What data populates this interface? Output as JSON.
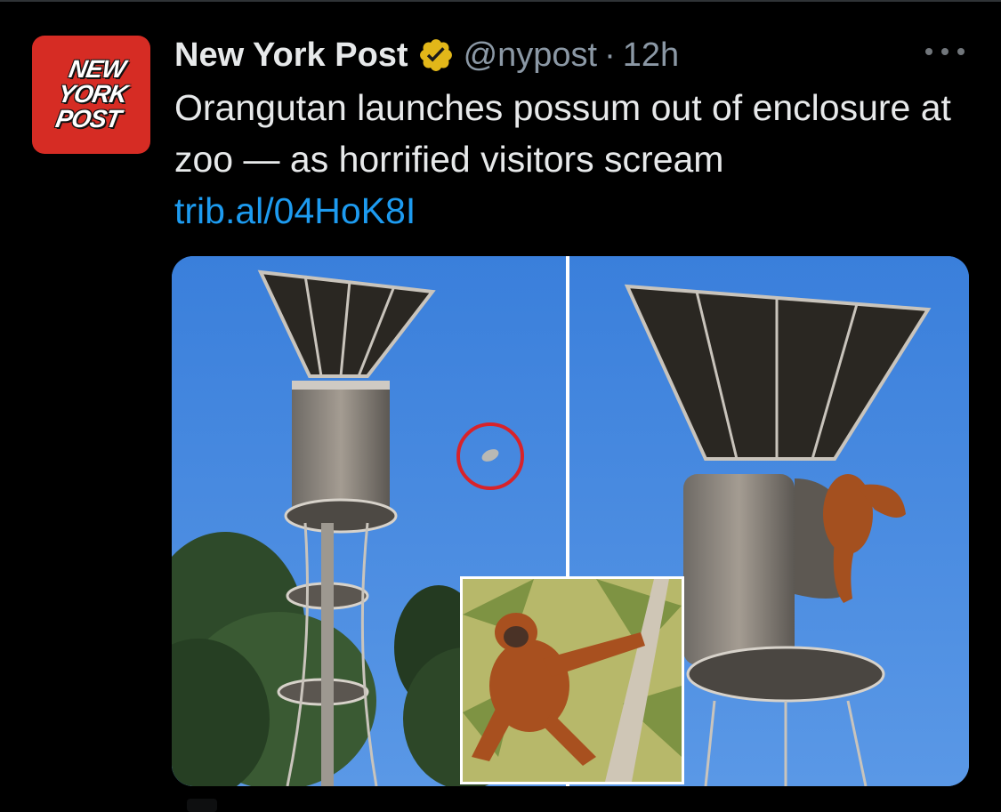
{
  "tweet": {
    "display_name": "New York Post",
    "handle": "@nypost",
    "separator": "·",
    "time": "12h",
    "text_main": "Orangutan launches possum out of enclosure at zoo — as horrified visitors scream ",
    "link": "trib.al/04HoK8I",
    "avatar_logo": [
      "NEW",
      "YORK",
      "POST"
    ],
    "verified_icon": "verified-gold-badge-icon",
    "more_icon": "more-horizontal-icon"
  },
  "colors": {
    "background": "#000000",
    "text": "#e7e9ea",
    "muted": "#8b98a5",
    "link": "#1d9bf0",
    "avatar_red": "#d62c24",
    "verified_gold": "#e2b719",
    "sky": "#3f82d9"
  }
}
